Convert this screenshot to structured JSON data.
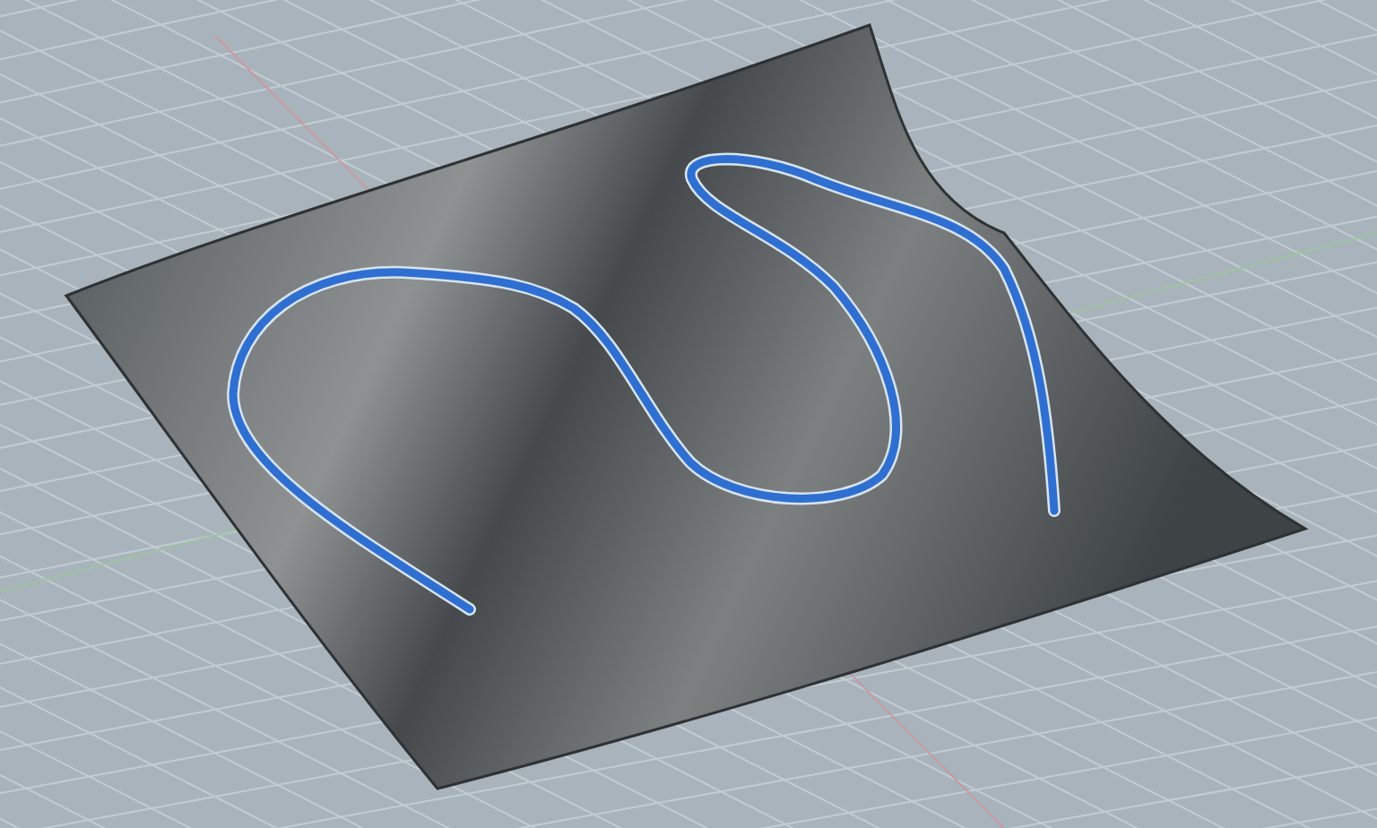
{
  "viewport": {
    "grid_visible": true,
    "curve_selected": true
  }
}
